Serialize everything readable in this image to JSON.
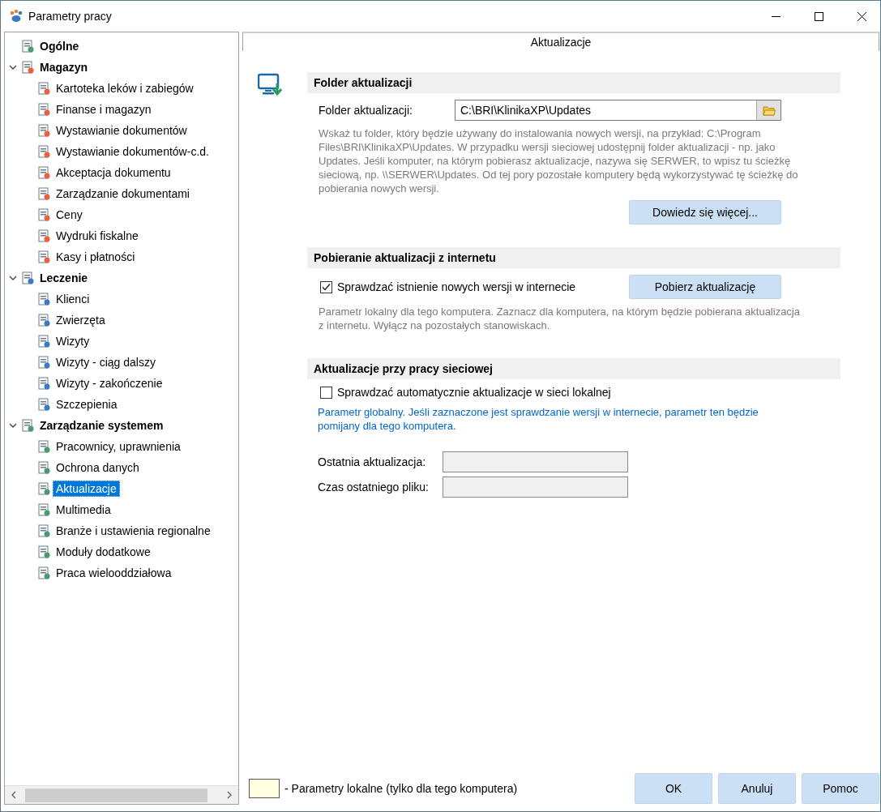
{
  "window": {
    "title": "Parametry pracy"
  },
  "tree": [
    {
      "label": "Ogólne",
      "selected": false
    },
    {
      "label": "Magazyn",
      "expanded": true,
      "selected": false,
      "children": [
        {
          "label": "Kartoteka leków i zabiegów",
          "selected": false
        },
        {
          "label": "Finanse i magazyn",
          "selected": false
        },
        {
          "label": "Wystawianie dokumentów",
          "selected": false
        },
        {
          "label": "Wystawianie dokumentów-c.d.",
          "selected": false
        },
        {
          "label": "Akceptacja dokumentu",
          "selected": false
        },
        {
          "label": "Zarządzanie dokumentami",
          "selected": false
        },
        {
          "label": "Ceny",
          "selected": false
        },
        {
          "label": "Wydruki fiskalne",
          "selected": false
        },
        {
          "label": "Kasy i płatności",
          "selected": false
        }
      ]
    },
    {
      "label": "Leczenie",
      "expanded": true,
      "selected": false,
      "children": [
        {
          "label": "Klienci",
          "selected": false
        },
        {
          "label": "Zwierzęta",
          "selected": false
        },
        {
          "label": "Wizyty",
          "selected": false
        },
        {
          "label": "Wizyty - ciąg dalszy",
          "selected": false
        },
        {
          "label": "Wizyty - zakończenie",
          "selected": false
        },
        {
          "label": "Szczepienia",
          "selected": false
        }
      ]
    },
    {
      "label": "Zarządzanie systemem",
      "expanded": true,
      "selected": false,
      "children": [
        {
          "label": "Pracownicy, uprawnienia",
          "selected": false
        },
        {
          "label": "Ochrona danych",
          "selected": false
        },
        {
          "label": "Aktualizacje",
          "selected": true
        },
        {
          "label": "Multimedia",
          "selected": false
        },
        {
          "label": "Branże i ustawienia regionalne",
          "selected": false
        },
        {
          "label": "Moduły dodatkowe",
          "selected": false
        },
        {
          "label": "Praca wielooddziałowa",
          "selected": false
        }
      ]
    }
  ],
  "panel": {
    "title": "Aktualizacje",
    "folder_section": {
      "title": "Folder aktualizacji",
      "field_label": "Folder aktualizacji:",
      "field_value": "C:\\BRI\\KlinikaXP\\Updates",
      "description": "Wskaż tu folder, który będzie używany do instalowania nowych wersji, na przykład: C:\\Program Files\\BRI\\KlinikaXP\\Updates. W przypadku wersji sieciowej udostępnij folder  aktualizacji - np. jako Updates. Jeśli komputer, na którym pobierasz aktualizacje, nazywa się SERWER, to wpisz tu ścieżkę sieciową, np. \\\\SERWER\\Updates. Od tej pory pozostałe komputery będą wykorzystywać tę ścieżkę do pobierania nowych wersji.",
      "button": "Dowiedz się więcej..."
    },
    "download_section": {
      "title": "Pobieranie aktualizacji z internetu",
      "checkbox": {
        "label": "Sprawdzać istnienie nowych wersji w internecie",
        "checked": true
      },
      "button": "Pobierz aktualizację",
      "description": "Parametr lokalny dla tego komputera. Zaznacz dla komputera, na którym będzie pobierana aktualizacja z internetu. Wyłącz na pozostałych stanowiskach."
    },
    "network_section": {
      "title": "Aktualizacje przy pracy sieciowej",
      "checkbox": {
        "label": "Sprawdzać automatycznie aktualizacje w sieci lokalnej",
        "checked": false
      },
      "note": "Parametr globalny. Jeśli zaznaczone jest sprawdzanie wersji w internecie, parametr ten będzie pomijany dla tego komputera.",
      "fields": [
        {
          "label": "Ostatnia aktualizacja:"
        },
        {
          "label": "Czas ostatniego pliku:"
        }
      ]
    }
  },
  "legend": {
    "label": "- Parametry lokalne (tylko dla tego komputera)"
  },
  "buttons": [
    "OK",
    "Anuluj",
    "Pomoc"
  ]
}
